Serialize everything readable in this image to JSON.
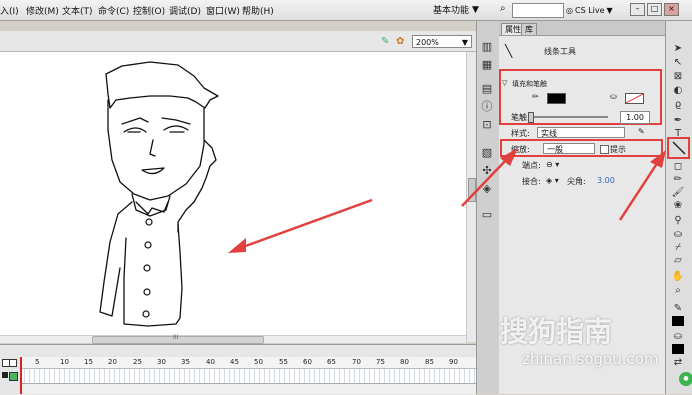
{
  "menu": [
    "入(I)",
    "修改(M)",
    "文本(T)",
    "命令(C)",
    "控制(O)",
    "调试(D)",
    "窗口(W)",
    "帮助(H)"
  ],
  "workspace": {
    "label": "基本功能",
    "arrow": "▼"
  },
  "search": {
    "icon": "search-icon"
  },
  "cslive": {
    "label": "CS Live",
    "arrow": "▼"
  },
  "window_buttons": [
    "–",
    "□",
    "×"
  ],
  "stage": {
    "zoom": "200%",
    "arrow": "▼",
    "scroll_label": "III"
  },
  "timeline": {
    "frame_numbers": [
      "5",
      "10",
      "15",
      "20",
      "25",
      "30",
      "35",
      "40",
      "45",
      "50",
      "55",
      "60",
      "65",
      "70",
      "75",
      "80",
      "85",
      "90"
    ]
  },
  "properties": {
    "tab_props": "属性",
    "tab_library": "库",
    "tool_name": "线条工具",
    "section_fill_stroke": "填充和笔触",
    "stroke_label": "笔触:",
    "stroke_value": "1.00",
    "style_label": "样式:",
    "style_value": "实线",
    "scale_label": "缩放:",
    "scale_value": "一般",
    "hint_label": "提示",
    "cap_label": "端点:",
    "join_label": "接合:",
    "miter_label": "尖角:",
    "miter_value": "3.00"
  },
  "watermark": {
    "text": "搜狗指南",
    "url": "zhinan.sogou.com"
  },
  "colors": {
    "annotation": "#e1403e",
    "stroke": "#000000",
    "fill": "#ffffff"
  }
}
